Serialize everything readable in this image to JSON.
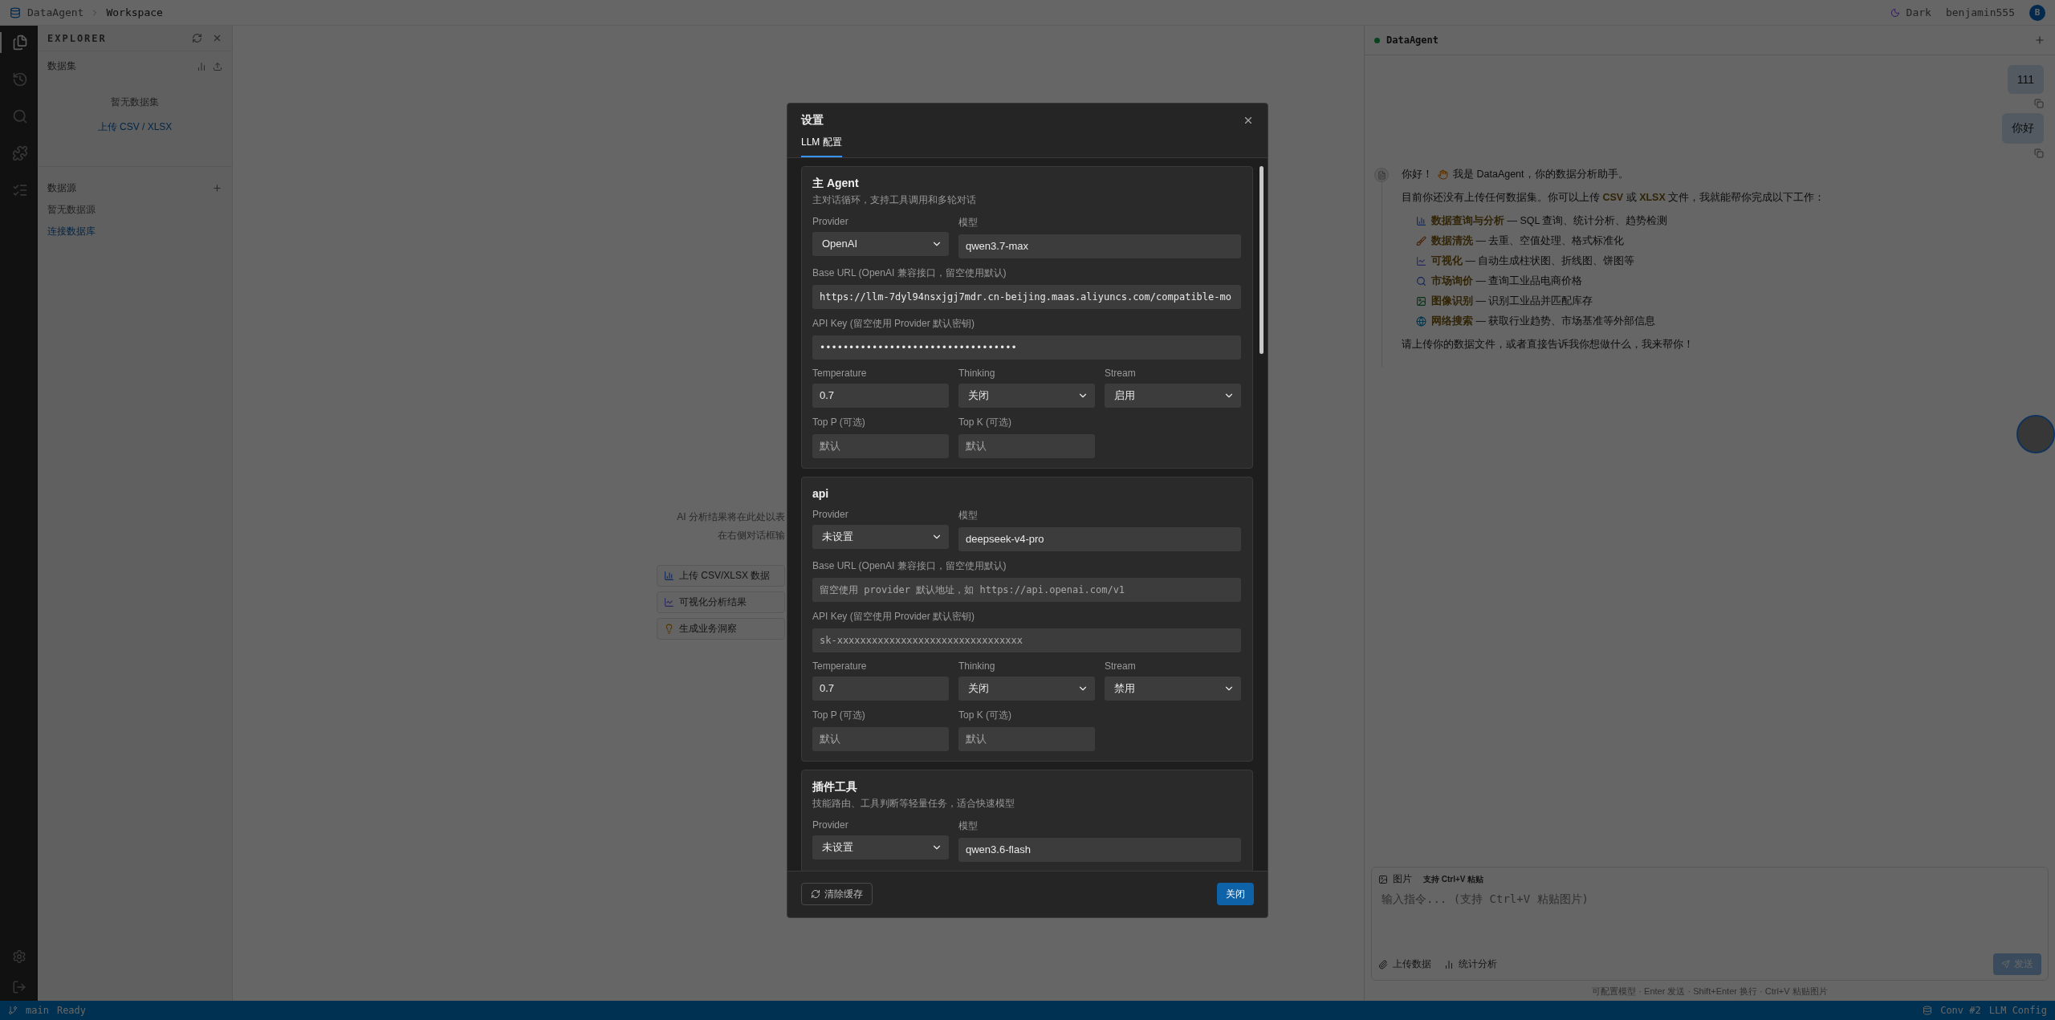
{
  "top_bar": {
    "app_name": "DataAgent",
    "breadcrumb": "Workspace",
    "theme_toggle": "Dark",
    "username": "benjamin555",
    "avatar_letter": "B"
  },
  "activity_bar": {
    "items": [
      {
        "kind": "files",
        "selected": true
      },
      {
        "kind": "history",
        "selected": false
      },
      {
        "kind": "search",
        "selected": false
      },
      {
        "kind": "plugins",
        "selected": false
      },
      {
        "kind": "tasks",
        "selected": false
      }
    ],
    "bottom": [
      {
        "kind": "settings"
      },
      {
        "kind": "logout"
      }
    ]
  },
  "explorer": {
    "title": "EXPLORER",
    "datasets": {
      "title": "数据集",
      "empty": "暂无数据集",
      "link": "上传 CSV / XLSX"
    },
    "sources": {
      "title": "数据源",
      "empty": "暂无数据源",
      "link": "连接数据库"
    }
  },
  "workspace": {
    "lines": [
      "AI 分析结果将在此处以表",
      "在右侧对话框输"
    ],
    "actions": [
      {
        "kind": "chart",
        "label": "上传 CSV/XLSX 数据"
      },
      {
        "kind": "trend",
        "label": "可视化分析结果"
      },
      {
        "kind": "bulb",
        "label": "生成业务洞察"
      }
    ]
  },
  "chat": {
    "title": "DataAgent",
    "online": true,
    "user_messages": [
      "111",
      "你好"
    ],
    "assistant": {
      "greeting": "你好！",
      "intro": "我是 DataAgent，你的数据分析助手。",
      "paragraph": "目前你还没有上传任何数据集。你可以上传 **CSV** 或 **XLSX** 文件，我就能帮你完成以下工作：",
      "items": [
        {
          "kind": "chart",
          "text": "**数据查询与分析** — SQL 查询、统计分析、趋势检测"
        },
        {
          "kind": "brush",
          "text": "**数据清洗** — 去重、空值处理、格式标准化"
        },
        {
          "kind": "trend",
          "text": "**可视化** — 自动生成柱状图、折线图、饼图等"
        },
        {
          "kind": "search",
          "text": "**市场询价** — 查询工业品电商价格"
        },
        {
          "kind": "image",
          "text": "**图像识别** — 识别工业品并匹配库存"
        },
        {
          "kind": "globe",
          "text": "**网络搜索** — 获取行业趋势、市场基准等外部信息"
        }
      ],
      "closing": "请上传你的数据文件，或者直接告诉我你想做什么，我来帮你！"
    },
    "composer": {
      "image_label": "图片",
      "paste_hint": "支持 Ctrl+V 粘贴",
      "placeholder": "输入指令... (支持 Ctrl+V 粘贴图片)",
      "upload": "上传数据",
      "stats": "统计分析",
      "send": "发送",
      "send_disabled": true
    },
    "hint": "可配置模型 · Enter 发送 · Shift+Enter 换行 · Ctrl+V 粘贴图片"
  },
  "status_bar": {
    "branch": "main",
    "state": "Ready",
    "conversation": "Conv #2",
    "config": "LLM Config"
  },
  "modal": {
    "title": "设置",
    "tabs": [
      {
        "label": "LLM 配置",
        "selected": true
      }
    ],
    "sections": [
      {
        "title": "主 Agent",
        "description": "主对话循环，支持工具调用和多轮对话",
        "provider": {
          "label": "Provider",
          "value": "OpenAI"
        },
        "model": {
          "label": "模型",
          "value": "qwen3.7-max"
        },
        "base_url": {
          "label": "Base URL (OpenAI 兼容接口，留空使用默认)",
          "value": "https://llm-7dyl94nsxjgj7mdr.cn-beijing.maas.aliyuncs.com/compatible-mo"
        },
        "api_key": {
          "label": "API Key (留空使用 Provider 默认密钥)",
          "value": "••••••••••••••••••••••••••••••••••"
        },
        "temperature": {
          "label": "Temperature",
          "value": "0.7"
        },
        "thinking": {
          "label": "Thinking",
          "value": "关闭"
        },
        "stream": {
          "label": "Stream",
          "value": "启用"
        },
        "top_p": {
          "label": "Top P (可选)",
          "placeholder": "默认"
        },
        "top_k": {
          "label": "Top K (可选)",
          "placeholder": "默认"
        }
      },
      {
        "title": "api",
        "provider": {
          "label": "Provider",
          "value": "未设置"
        },
        "model": {
          "label": "模型",
          "value": "deepseek-v4-pro"
        },
        "base_url": {
          "label": "Base URL (OpenAI 兼容接口，留空使用默认)",
          "placeholder": "留空使用 provider 默认地址，如 https://api.openai.com/v1"
        },
        "api_key": {
          "label": "API Key (留空使用 Provider 默认密钥)",
          "placeholder": "sk-xxxxxxxxxxxxxxxxxxxxxxxxxxxxxxxx"
        },
        "temperature": {
          "label": "Temperature",
          "value": "0.7"
        },
        "thinking": {
          "label": "Thinking",
          "value": "关闭"
        },
        "stream": {
          "label": "Stream",
          "value": "禁用"
        },
        "top_p": {
          "label": "Top P (可选)",
          "placeholder": "默认"
        },
        "top_k": {
          "label": "Top K (可选)",
          "placeholder": "默认"
        }
      },
      {
        "title": "插件工具",
        "description": "技能路由、工具判断等轻量任务，适合快速模型",
        "provider": {
          "label": "Provider",
          "value": "未设置"
        },
        "model": {
          "label": "模型",
          "value": "qwen3.6-flash"
        }
      }
    ],
    "clear_button": "清除缓存",
    "close_button": "关闭"
  }
}
